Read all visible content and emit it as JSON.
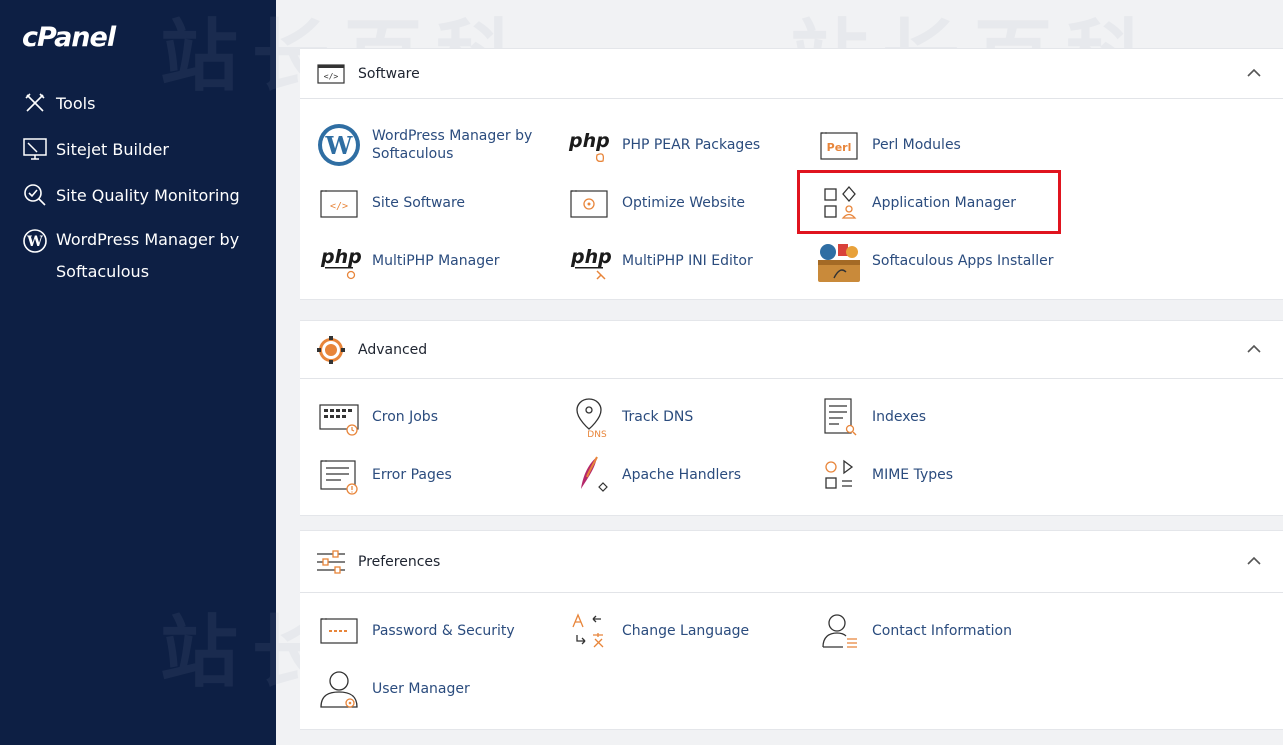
{
  "sidebar": {
    "logo": "cPanel",
    "items": [
      {
        "label": "Tools",
        "icon": "tools-icon"
      },
      {
        "label": "Sitejet Builder",
        "icon": "sitejet-icon"
      },
      {
        "label": "Site Quality Monitoring",
        "icon": "site-quality-icon"
      },
      {
        "label": "WordPress Manager by Softaculous",
        "icon": "wordpress-icon"
      }
    ]
  },
  "panels": {
    "software": {
      "title": "Software",
      "items": [
        {
          "label": "WordPress Manager by Softaculous",
          "icon": "wordpress-icon"
        },
        {
          "label": "PHP PEAR Packages",
          "icon": "php-pear-icon"
        },
        {
          "label": "Perl Modules",
          "icon": "perl-icon"
        },
        {
          "label": "Site Software",
          "icon": "site-software-icon"
        },
        {
          "label": "Optimize Website",
          "icon": "optimize-icon"
        },
        {
          "label": "Application Manager",
          "icon": "application-manager-icon"
        },
        {
          "label": "MultiPHP Manager",
          "icon": "multiphp-manager-icon"
        },
        {
          "label": "MultiPHP INI Editor",
          "icon": "multiphp-ini-icon"
        },
        {
          "label": "Softaculous Apps Installer",
          "icon": "softaculous-icon"
        }
      ]
    },
    "advanced": {
      "title": "Advanced",
      "items": [
        {
          "label": "Cron Jobs",
          "icon": "cron-icon"
        },
        {
          "label": "Track DNS",
          "icon": "track-dns-icon"
        },
        {
          "label": "Indexes",
          "icon": "indexes-icon"
        },
        {
          "label": "Error Pages",
          "icon": "error-pages-icon"
        },
        {
          "label": "Apache Handlers",
          "icon": "apache-icon"
        },
        {
          "label": "MIME Types",
          "icon": "mime-icon"
        }
      ]
    },
    "preferences": {
      "title": "Preferences",
      "items": [
        {
          "label": "Password & Security",
          "icon": "password-icon"
        },
        {
          "label": "Change Language",
          "icon": "language-icon"
        },
        {
          "label": "Contact Information",
          "icon": "contact-icon"
        },
        {
          "label": "User Manager",
          "icon": "user-manager-icon"
        }
      ]
    }
  },
  "icon_text": {
    "php": "php",
    "perl": "Perl",
    "dns": "DNS",
    "code": "</>"
  },
  "colors": {
    "sidebar_bg": "#0d1f44",
    "link": "#2b4c7e",
    "accent_orange": "#e8853a",
    "highlight_red": "#e0141f"
  },
  "watermark": "站长百科"
}
